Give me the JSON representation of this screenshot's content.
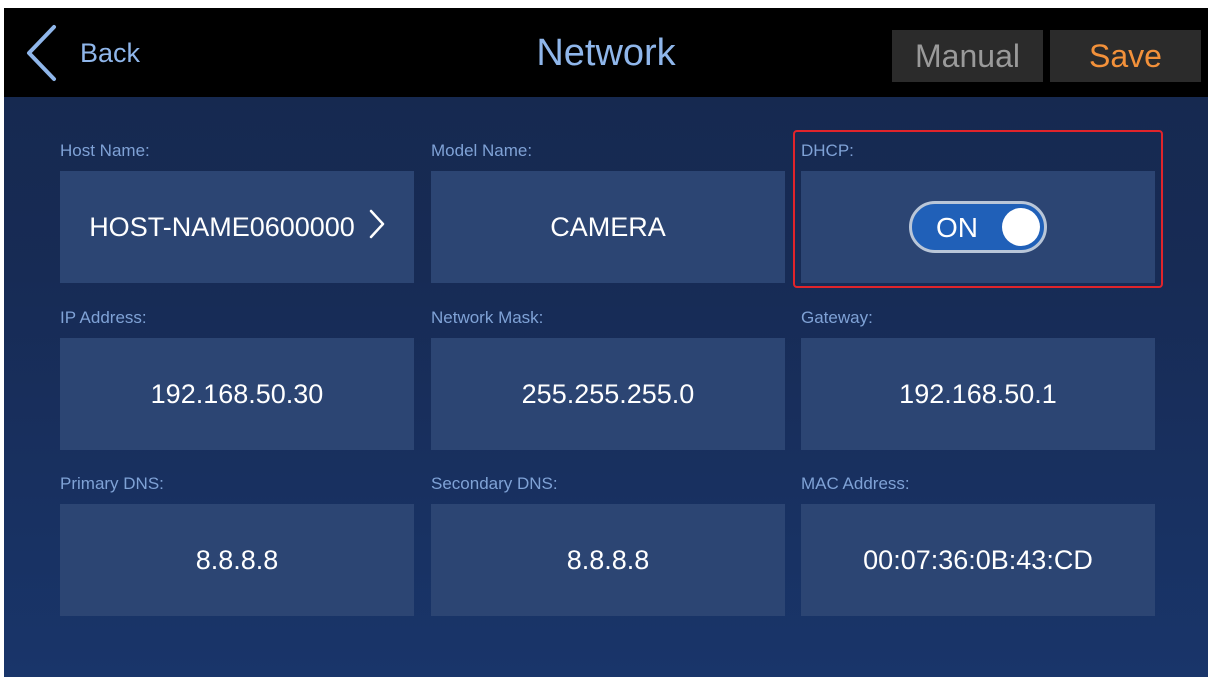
{
  "header": {
    "back_label": "Back",
    "title": "Network",
    "manual_label": "Manual",
    "save_label": "Save"
  },
  "fields": {
    "host_name": {
      "label": "Host Name:",
      "value": "HOST-NAME0600000"
    },
    "model_name": {
      "label": "Model Name:",
      "value": "CAMERA"
    },
    "dhcp": {
      "label": "DHCP:",
      "value": "ON",
      "state": true
    },
    "ip_address": {
      "label": "IP Address:",
      "value": "192.168.50.30"
    },
    "network_mask": {
      "label": "Network Mask:",
      "value": "255.255.255.0"
    },
    "gateway": {
      "label": "Gateway:",
      "value": "192.168.50.1"
    },
    "primary_dns": {
      "label": "Primary DNS:",
      "value": "8.8.8.8"
    },
    "secondary_dns": {
      "label": "Secondary DNS:",
      "value": "8.8.8.8"
    },
    "mac_address": {
      "label": "MAC Address:",
      "value": "00:07:36:0B:43:CD"
    }
  },
  "icons": {
    "back": "chevron-left-icon",
    "host_more": "chevron-right-icon"
  },
  "colors": {
    "accent_text": "#8fb6ea",
    "save_text": "#f3913a",
    "highlight_border": "#e0242b",
    "toggle_on": "#2060b8"
  }
}
